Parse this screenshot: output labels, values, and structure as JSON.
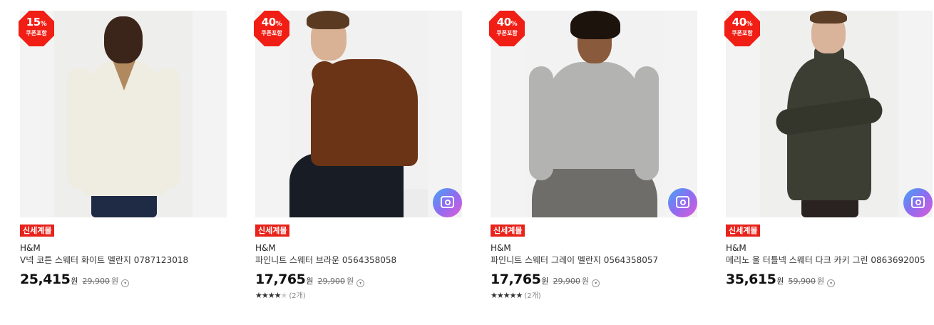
{
  "products": [
    {
      "discount": "15",
      "discount_unit": "%",
      "coupon_label": "쿠폰포함",
      "tag": "신세계몰",
      "brand": "H&M",
      "name": "V넥 코튼 스웨터 화이트 멜란지 0787123018",
      "price": "25,415",
      "price_unit": "원",
      "original_price": "29,900",
      "original_unit": "원",
      "info_icon": "info-circle-icon",
      "has_camera": false,
      "sweater_color": "#efece2",
      "rating": null,
      "review_count": null
    },
    {
      "discount": "40",
      "discount_unit": "%",
      "coupon_label": "쿠폰포함",
      "tag": "신세계몰",
      "brand": "H&M",
      "name": "파인니트 스웨터 브라운 0564358058",
      "price": "17,765",
      "price_unit": "원",
      "original_price": "29,900",
      "original_unit": "원",
      "info_icon": "info-circle-icon",
      "has_camera": true,
      "camera_icon": "camera-icon",
      "sweater_color": "#6b3417",
      "rating": 4,
      "review_count": "(2개)"
    },
    {
      "discount": "40",
      "discount_unit": "%",
      "coupon_label": "쿠폰포함",
      "tag": "신세계몰",
      "brand": "H&M",
      "name": "파인니트 스웨터 그레이 멜란지 0564358057",
      "price": "17,765",
      "price_unit": "원",
      "original_price": "29,900",
      "original_unit": "원",
      "info_icon": "info-circle-icon",
      "has_camera": true,
      "camera_icon": "camera-icon",
      "sweater_color": "#b3b3b1",
      "rating": 5,
      "review_count": "(2개)"
    },
    {
      "discount": "40",
      "discount_unit": "%",
      "coupon_label": "쿠폰포함",
      "tag": "신세계몰",
      "brand": "H&M",
      "name": "메리노 울 터틀넥 스웨터 다크 카키 그린 0863692005",
      "price": "35,615",
      "price_unit": "원",
      "original_price": "59,900",
      "original_unit": "원",
      "info_icon": "info-circle-icon",
      "has_camera": true,
      "camera_icon": "camera-icon",
      "sweater_color": "#3c3e33",
      "rating": null,
      "review_count": null
    }
  ],
  "colors": {
    "badge": "#f01e14",
    "tag": "#e8231b",
    "camera_gradient": [
      "#42a5f5",
      "#8e6cf0",
      "#e05bd8"
    ]
  }
}
